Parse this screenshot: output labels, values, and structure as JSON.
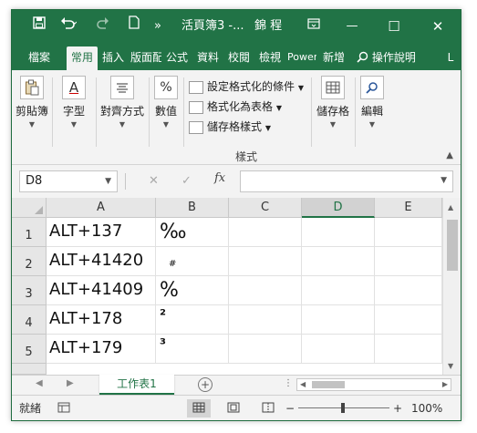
{
  "title_bar": {
    "save_icon": "save-icon",
    "undo_icon": "undo-icon",
    "redo_icon": "redo-icon",
    "new_icon": "new-file-icon",
    "more_label": "»",
    "title": "活頁簿3 -...",
    "status": "錦 程",
    "ribbon_display_icon": "ribbon-display-icon",
    "minimize_label": "—",
    "maximize_label": "☐",
    "close_label": "✕"
  },
  "tabs": [
    {
      "label": "檔案"
    },
    {
      "label": "常用"
    },
    {
      "label": "插入"
    },
    {
      "label": "版面配置"
    },
    {
      "label": "公式"
    },
    {
      "label": "資料"
    },
    {
      "label": "校閱"
    },
    {
      "label": "檢視"
    },
    {
      "label": "Power Pivot"
    },
    {
      "label": "新增"
    },
    {
      "label": "操作說明"
    },
    {
      "label": "L"
    }
  ],
  "ribbon": {
    "clipboard": "剪貼簿",
    "font": "字型",
    "alignment": "對齊方式",
    "number": "數值",
    "number_symbol": "%",
    "conditional_format": "設定格式化的條件",
    "format_as_table": "格式化為表格",
    "cell_styles": "儲存格樣式",
    "styles_group": "樣式",
    "cells": "儲存格",
    "editing": "編輯"
  },
  "formula_bar": {
    "name_box": "D8",
    "cancel_label": "✕",
    "enter_label": "✓",
    "fx_label": "fx",
    "formula": ""
  },
  "columns": [
    "A",
    "B",
    "C",
    "D",
    "E"
  ],
  "selected_column": "D",
  "rows": [
    {
      "num": "1",
      "a": "ALT+137",
      "b": "‰"
    },
    {
      "num": "2",
      "a": "ALT+41420",
      "b": "#"
    },
    {
      "num": "3",
      "a": "ALT+41409",
      "b": "%"
    },
    {
      "num": "4",
      "a": "ALT+178",
      "b": "²"
    },
    {
      "num": "5",
      "a": "ALT+179",
      "b": "³"
    }
  ],
  "sheet_tabs": {
    "prev_label": "◀",
    "next_label": "▶",
    "active": "工作表1",
    "add_label": "+"
  },
  "status_bar": {
    "status": "就緒",
    "zoom_minus": "−",
    "zoom_plus": "+",
    "zoom": "100%"
  }
}
